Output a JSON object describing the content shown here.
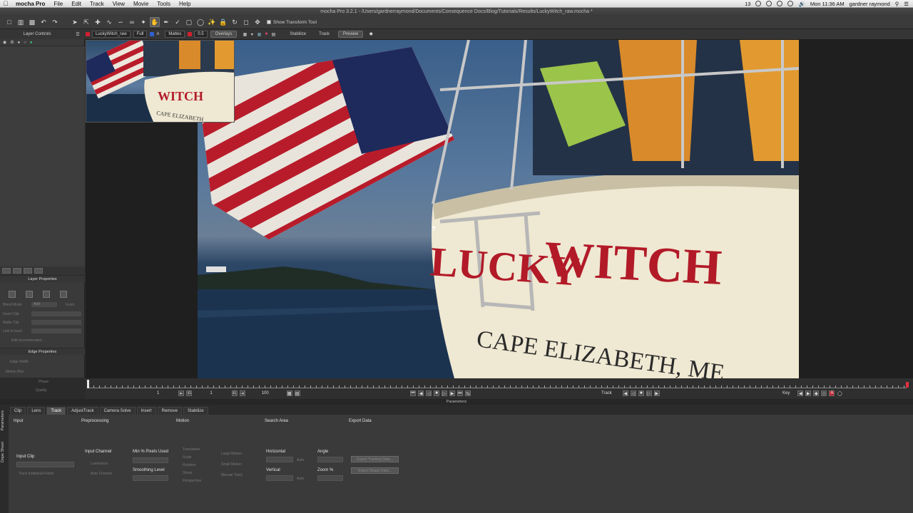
{
  "menubar": {
    "app": "mocha Pro",
    "items": [
      "File",
      "Edit",
      "Track",
      "View",
      "Movie",
      "Tools",
      "Help"
    ],
    "status_badge": "13",
    "clock": "Mon 11:36 AM",
    "user": "gardner raymond"
  },
  "window": {
    "title": "mocha Pro 3.2.1  -  /Users/gardnerraymond/Documents/Consequence Docs/Blog/Tutorials/Results/LuckyWitch_raw.mocha *"
  },
  "toolbar": {
    "show_transform_label": "Show Transform Tool"
  },
  "viewer_bar": {
    "clip": "LuckyWitch_raw",
    "resolution": "Full",
    "mattes_label": "Mattes",
    "opacity": "0.5",
    "overlays_label": "Overlays",
    "stabilize_label": "Stabilize",
    "track_label": "Track",
    "preview_label": "Preview"
  },
  "layer_controls": {
    "title": "Layer Controls"
  },
  "layer_properties": {
    "title": "Layer Properties",
    "rows": [
      "Blend Mode",
      "Insert Clip",
      "Matte Clip",
      "Link to track"
    ],
    "blend_mode_value": "Add",
    "blend_mode_extra": "Invert",
    "link_note": "Edit recommended..."
  },
  "edge_properties": {
    "title": "Edge Properties",
    "rows": [
      "Edge Width",
      "Motion Blur",
      "Phase",
      "Quality"
    ]
  },
  "timeline": {
    "in_frame": "1",
    "current_frame": "1",
    "out_frame": "100",
    "track_label": "Track",
    "key_label": "Key"
  },
  "params": {
    "header": "Parameters",
    "tabs": [
      "Clip",
      "Lens",
      "Track",
      "AdjustTrack",
      "Camera Solve",
      "Insert",
      "Remove",
      "Stabilize"
    ],
    "active_tab": "Track",
    "side_tabs": [
      "Parameters",
      "Dope Sheet"
    ],
    "sections": {
      "input": "Input",
      "preprocessing": "Preprocessing",
      "motion": "Motion",
      "search_area": "Search Area",
      "export_data": "Export Data"
    },
    "input_clip_label": "Input Clip",
    "track_individual_fields": "Track Individual Fields",
    "input_channel_label": "Input Channel",
    "luminance_option": "Luminance",
    "auto_channel_option": "Auto Channel",
    "min_pixels_label": "Min % Pixels Used",
    "smoothing_label": "Smoothing Level",
    "motion_options": [
      "Translation",
      "Scale",
      "Rotation",
      "Shear",
      "Perspective"
    ],
    "motion_choices": [
      "Large Motion",
      "Small Motion",
      "Manual Track"
    ],
    "horizontal_label": "Horizontal",
    "vertical_label": "Vertical",
    "auto_label": "Auto",
    "angle_label": "Angle",
    "zoom_label": "Zoom %",
    "export_tracking": "Export Tracking Data...",
    "export_shape": "Export Shape Data..."
  }
}
